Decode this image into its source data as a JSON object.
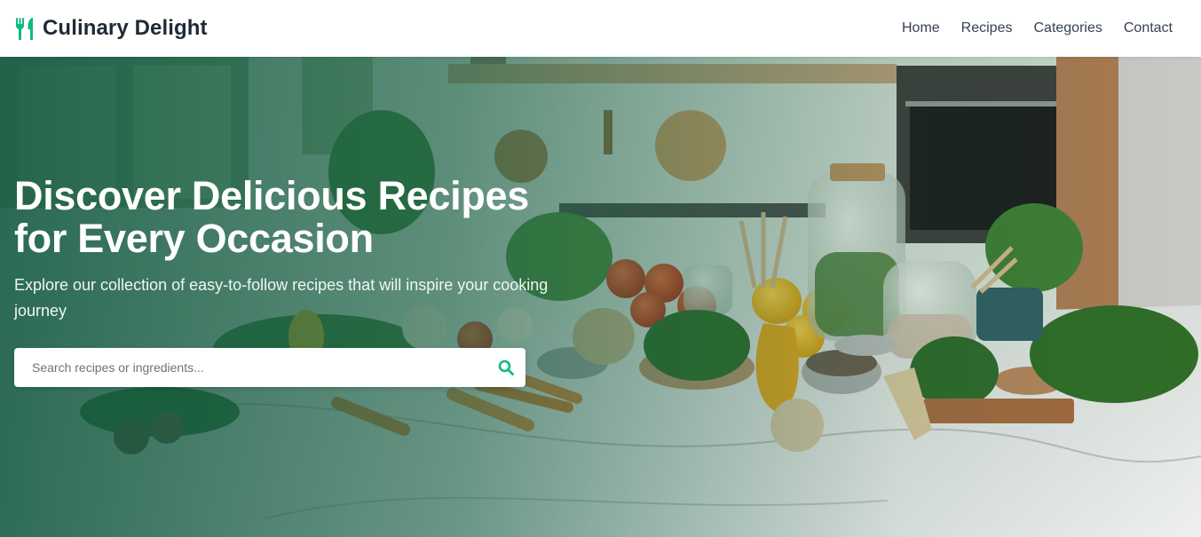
{
  "header": {
    "brand": "Culinary Delight",
    "brand_icon": "utensils-icon",
    "accent_color": "#10b981",
    "nav": [
      "Home",
      "Recipes",
      "Categories",
      "Contact"
    ]
  },
  "hero": {
    "title_line1": "Discover Delicious Recipes",
    "title_line2": "for Every Occasion",
    "subtitle": "Explore our collection of easy-to-follow recipes that will inspire your cooking journey",
    "background": "kitchen-counter-vegetables-photo"
  },
  "search": {
    "placeholder": "Search recipes or ingredients...",
    "value": "",
    "icon": "search-icon"
  }
}
